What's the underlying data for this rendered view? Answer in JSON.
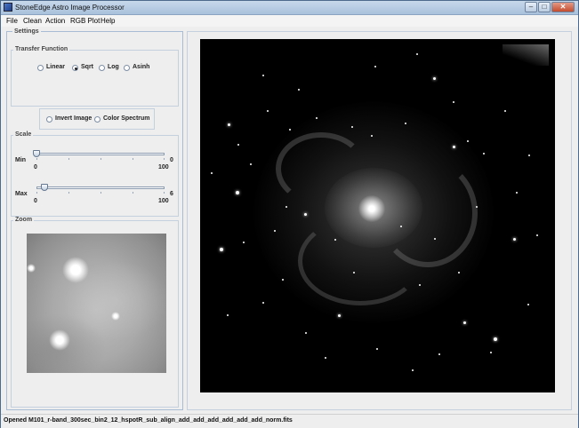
{
  "window": {
    "title": "StoneEdge Astro Image Processor",
    "min_label": "–",
    "max_label": "□",
    "close_label": "✕"
  },
  "menu": [
    "File",
    "Clean",
    "Action",
    "RGB Plot",
    "Help"
  ],
  "settings": {
    "title": "Settings",
    "transfer": {
      "title": "Transfer Function",
      "options": [
        "Linear",
        "Sqrt",
        "Log",
        "Asinh"
      ],
      "selected": "Sqrt"
    },
    "toggles": [
      "Invert Image",
      "Color Spectrum"
    ],
    "scale": {
      "title": "Scale",
      "min": {
        "label": "Min",
        "value": "0",
        "range_min": "0",
        "range_max": "100",
        "level": 0.0
      },
      "max": {
        "label": "Max",
        "value": "6",
        "range_min": "0",
        "range_max": "100",
        "level": 0.06
      }
    },
    "zoom": {
      "title": "Zoom"
    }
  },
  "status": "Opened M101_r-band_300sec_bin2_12_hspotR_sub_align_add_add_add_add_add_add_norm.fits",
  "icons": {
    "app": "app-icon",
    "minimize": "minimize-icon",
    "maximize": "maximize-icon",
    "close": "close-icon"
  }
}
